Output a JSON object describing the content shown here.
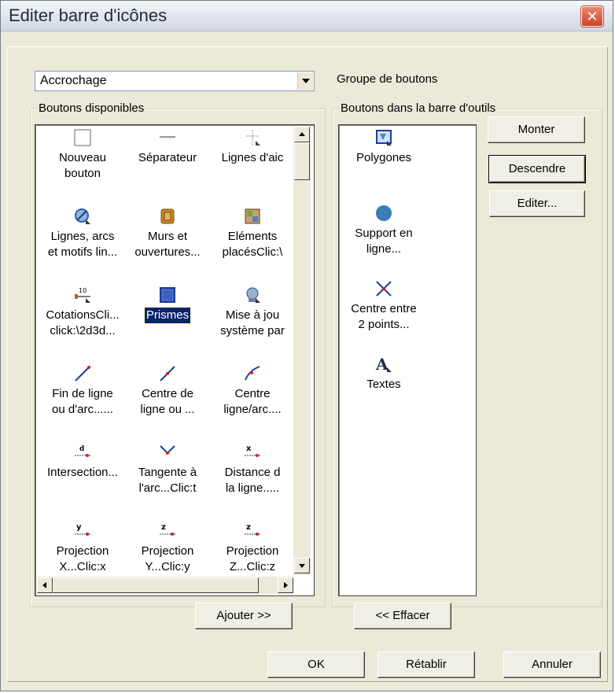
{
  "window": {
    "title": "Editer barre d'icônes",
    "close_glyph": "✕"
  },
  "combo": {
    "value": "Accrochage",
    "label": "Groupe de boutons"
  },
  "available": {
    "title": "Boutons disponibles",
    "items": [
      {
        "label": "Nouveau\nbouton",
        "icon": "blank-icon"
      },
      {
        "label": "Séparateur",
        "icon": "separator-icon"
      },
      {
        "label": "Lignes d'aic",
        "icon": "guide-lines-icon"
      },
      {
        "label": "Lignes, arcs\net motifs lin...",
        "icon": "lines-arcs-icon"
      },
      {
        "label": "Murs et\nouvertures...",
        "icon": "walls-icon"
      },
      {
        "label": "Eléments\nplacésClic:\\",
        "icon": "placed-elements-icon"
      },
      {
        "label": "CotationsCli...\nclick:\\2d3d...",
        "icon": "dimension-icon"
      },
      {
        "label": "Prismes",
        "icon": "prism-icon",
        "selected": true
      },
      {
        "label": "Mise à jou\nsystème par",
        "icon": "update-icon"
      },
      {
        "label": "Fin de ligne\nou d'arc......",
        "icon": "line-end-icon"
      },
      {
        "label": "Centre de\nligne ou ...",
        "icon": "line-center-icon"
      },
      {
        "label": "Centre\nligne/arc....",
        "icon": "arc-center-icon"
      },
      {
        "label": "Intersection...",
        "icon": "intersection-icon"
      },
      {
        "label": "Tangente à\nl'arc...Clic:t",
        "icon": "tangent-icon"
      },
      {
        "label": "Distance d\nla ligne.....",
        "icon": "distance-icon"
      },
      {
        "label": "Projection\nX...Clic:x",
        "icon": "projection-x-icon"
      },
      {
        "label": "Projection\nY...Clic:y",
        "icon": "projection-y-icon"
      },
      {
        "label": "Projection\nZ...Clic:z",
        "icon": "projection-z-icon"
      }
    ]
  },
  "toolbar": {
    "title": "Boutons dans la barre d'outils",
    "items": [
      {
        "label": "Polygones",
        "icon": "polygon-icon"
      },
      {
        "label": "Support en\nligne...",
        "icon": "globe-icon"
      },
      {
        "label": "Centre entre\n2 points...",
        "icon": "midpoint-icon"
      },
      {
        "label": "Textes",
        "icon": "text-icon"
      }
    ]
  },
  "buttons": {
    "up": "Monter",
    "down": "Descendre",
    "edit": "Editer...",
    "add": "Ajouter >>",
    "remove": "<< Effacer",
    "ok": "OK",
    "reset": "Rétablir",
    "cancel": "Annuler"
  }
}
